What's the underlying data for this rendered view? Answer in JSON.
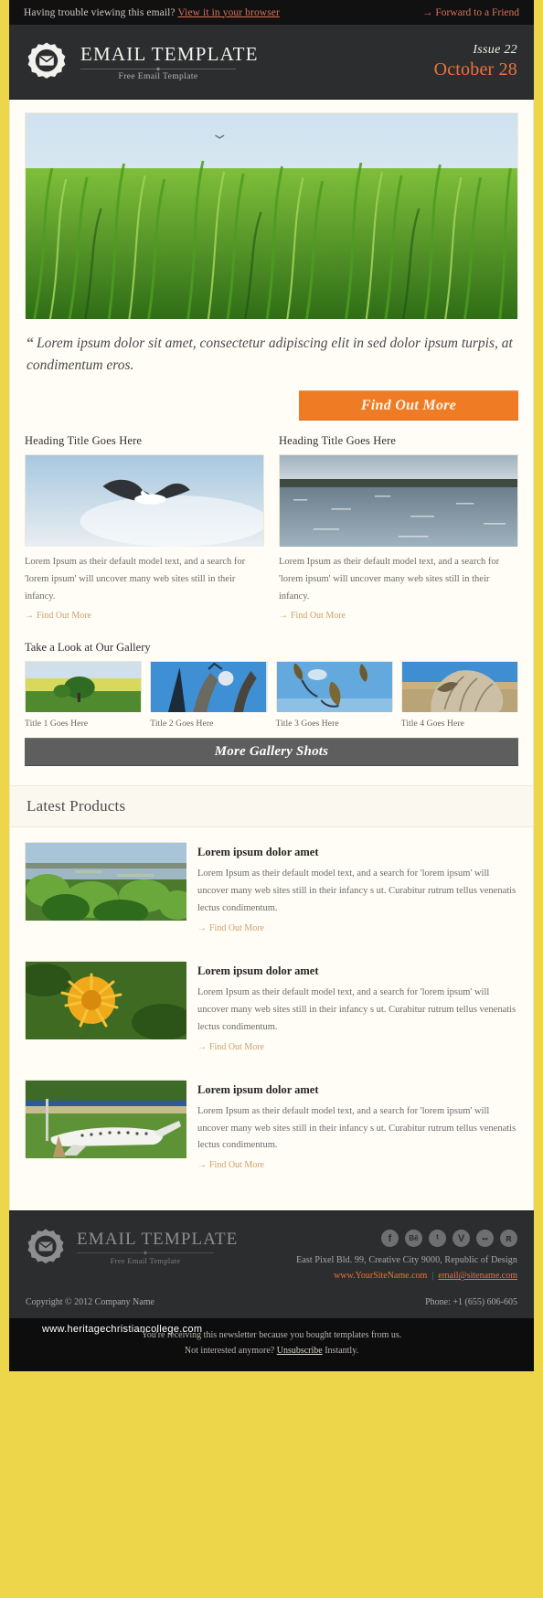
{
  "preheader": {
    "trouble_text": "Having trouble viewing this email?",
    "browser_link": "View it in your browser",
    "forward_arrow": "→",
    "forward_link": "Forward to a Friend"
  },
  "header": {
    "logo_icon": "envelope-seal-icon",
    "brand_title": "EMAIL TEMPLATE",
    "brand_subtitle": "Free Email Template",
    "issue_label": "Issue 22",
    "issue_date": "October 28",
    "accent_color": "#e8743a",
    "background_color": "#2c2d2f"
  },
  "hero": {
    "image_name": "green-grass-field-photo",
    "alt": "Green grass field under sky"
  },
  "quote": {
    "mark": "“",
    "text": "Lorem ipsum dolor sit amet, consectetur adipiscing elit in sed dolor ipsum turpis, at condimentum eros."
  },
  "cta": {
    "label": "Find Out More",
    "color": "#ef7c24"
  },
  "columns": [
    {
      "heading": "Heading Title Goes Here",
      "image_name": "seagull-in-flight-photo",
      "body": "Lorem Ipsum as their default model text, and a search for 'lorem ipsum' will uncover many web sites still in their infancy.",
      "link_arrow": "→",
      "link": "Find Out More"
    },
    {
      "heading": "Heading Title Goes Here",
      "image_name": "sea-shoreline-photo",
      "body": "Lorem Ipsum as their default model text, and a search for 'lorem ipsum' will uncover many web sites still in their infancy.",
      "link_arrow": "→",
      "link": "Find Out More"
    }
  ],
  "gallery": {
    "heading": "Take a Look at Our Gallery",
    "items": [
      {
        "caption": "Title 1 Goes Here",
        "image_name": "field-with-tree-photo"
      },
      {
        "caption": "Title 2 Goes Here",
        "image_name": "sculpture-against-sky-photo"
      },
      {
        "caption": "Title 3 Goes Here",
        "image_name": "dried-seed-pods-photo"
      },
      {
        "caption": "Title 4 Goes Here",
        "image_name": "weathered-rock-photo"
      }
    ],
    "more_button": "More Gallery Shots",
    "more_button_color": "#5e5e5e"
  },
  "products": {
    "section_title": "Latest Products",
    "items": [
      {
        "title": "Lorem ipsum dolor amet",
        "image_name": "estuary-landscape-photo",
        "body": "Lorem Ipsum as their default model text, and a search for 'lorem ipsum' will uncover many web sites still in their infancy s ut. Curabitur rutrum tellus venenatis lectus condimentum.",
        "link_arrow": "→",
        "link": "Find Out More"
      },
      {
        "title": "Lorem ipsum dolor amet",
        "image_name": "yellow-dandelion-flower-photo",
        "body": "Lorem Ipsum as their default model text, and a search for 'lorem ipsum' will uncover many web sites still in their infancy s ut. Curabitur rutrum tellus venenatis lectus condimentum.",
        "link_arrow": "→",
        "link": "Find Out More"
      },
      {
        "title": "Lorem ipsum dolor amet",
        "image_name": "parked-airplane-photo",
        "body": "Lorem Ipsum as their default model text, and a search for 'lorem ipsum' will uncover many web sites still in their infancy s ut. Curabitur rutrum tellus venenatis lectus condimentum.",
        "link_arrow": "→",
        "link": "Find Out More"
      }
    ]
  },
  "footer": {
    "logo_icon": "envelope-seal-icon",
    "brand_title": "EMAIL TEMPLATE",
    "brand_subtitle": "Free Email Template",
    "socials": [
      {
        "name": "facebook-icon",
        "glyph": "f"
      },
      {
        "name": "behance-icon",
        "glyph": "Bē"
      },
      {
        "name": "twitter-icon",
        "glyph": "ᵗ"
      },
      {
        "name": "vimeo-icon",
        "glyph": "V"
      },
      {
        "name": "flickr-icon",
        "glyph": "••"
      },
      {
        "name": "rss-icon",
        "glyph": "ʀ"
      }
    ],
    "address": "East Pixel Bld. 99, Creative City 9000, Republic of Design",
    "site_link": "www.YourSiteName.com",
    "email_link": "email@sitename.com",
    "copyright": "Copyright © 2012 Company Name",
    "phone": "Phone: +1 (655) 606-605"
  },
  "legal": {
    "line1": "You're receiving this newsletter because you bought templates from us.",
    "line2_pre": "Not interested anymore? ",
    "line2_link": "Unsubscribe",
    "line2_post": " Instantly.",
    "watermark": "www.heritagechristiancollege.com"
  }
}
